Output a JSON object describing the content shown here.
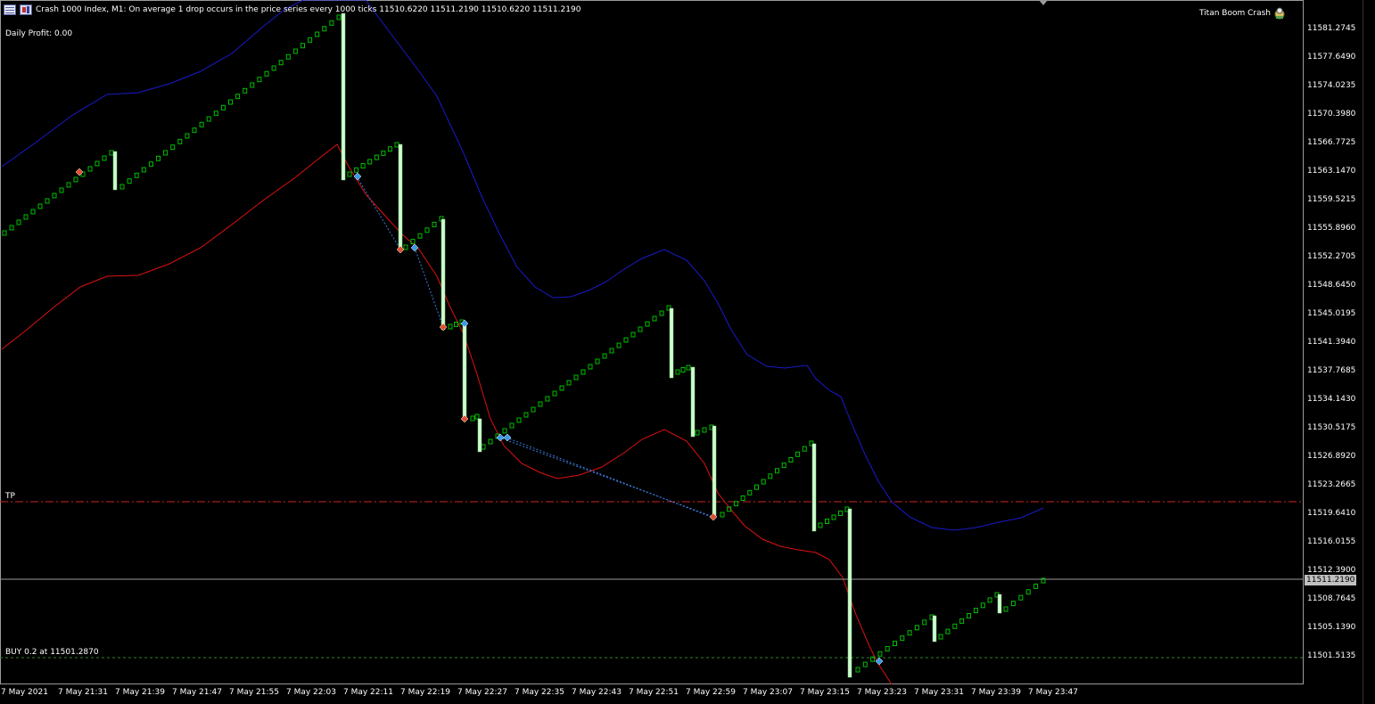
{
  "header": {
    "symbol_info": "Crash 1000 Index, M1:  On average 1 drop occurs in the price series every 1000 ticks  11510.6220 11511.2190 11510.6220 11511.2190",
    "daily_profit": "Daily Profit: 0.00",
    "ea_name": "Titan Boom Crash"
  },
  "price_scale": [
    "11581.2745",
    "11577.6490",
    "11574.0235",
    "11570.3980",
    "11566.7725",
    "11563.1470",
    "11559.5215",
    "11555.8960",
    "11552.2705",
    "11548.6450",
    "11545.0195",
    "11541.3940",
    "11537.7685",
    "11534.1430",
    "11530.5175",
    "11526.8920",
    "11523.2665",
    "11519.6410",
    "11516.0155",
    "11512.3900",
    "11508.7645",
    "11505.1390",
    "11501.5135"
  ],
  "current_price_tag": "11511.2190",
  "time_axis": [
    "7 May 2021",
    "7 May 21:31",
    "7 May 21:39",
    "7 May 21:47",
    "7 May 21:55",
    "7 May 22:03",
    "7 May 22:11",
    "7 May 22:19",
    "7 May 22:27",
    "7 May 22:35",
    "7 May 22:43",
    "7 May 22:51",
    "7 May 22:59",
    "7 May 23:07",
    "7 May 23:15",
    "7 May 23:23",
    "7 May 23:31",
    "7 May 23:39",
    "7 May 23:47"
  ],
  "lines": {
    "tp_label": "TP",
    "buy_label": "BUY 0.2 at 11501.2870"
  },
  "colors": {
    "background": "#000000",
    "bull_candle": "#00c000",
    "spike_candle": "#ccffcc",
    "upper_band": "#1a1acc",
    "lower_band": "#dd1111",
    "tp_line": "#cc2222",
    "buy_line": "#2a8a2a",
    "bid_line": "#9a9a9a",
    "trade_line": "#3a7ad8"
  }
}
